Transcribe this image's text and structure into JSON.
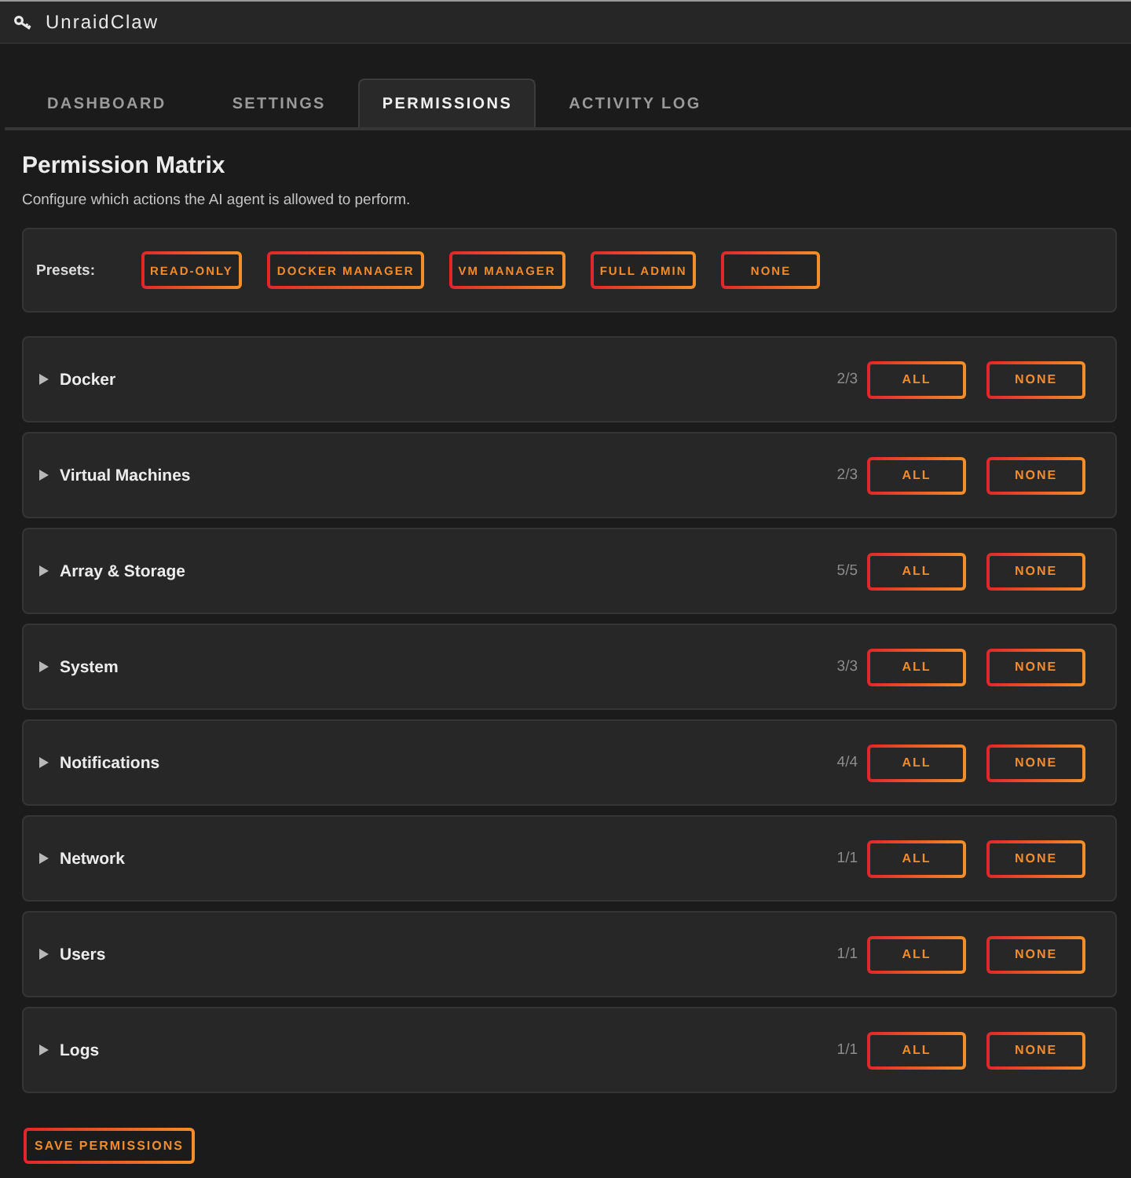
{
  "window": {
    "title": "UnraidClaw"
  },
  "tabs": [
    {
      "label": "DASHBOARD",
      "selected": false
    },
    {
      "label": "SETTINGS",
      "selected": false
    },
    {
      "label": "PERMISSIONS",
      "selected": true
    },
    {
      "label": "ACTIVITY LOG",
      "selected": false
    }
  ],
  "page": {
    "title": "Permission Matrix",
    "description": "Configure which actions the AI agent is allowed to perform."
  },
  "presets": {
    "label": "Presets:",
    "buttons": [
      "READ-ONLY",
      "DOCKER MANAGER",
      "VM MANAGER",
      "FULL ADMIN",
      "NONE"
    ]
  },
  "sections": [
    {
      "name": "Docker",
      "expanded": false,
      "count": "2/3",
      "all_button": "ALL",
      "none_button": "NONE"
    },
    {
      "name": "Virtual Machines",
      "expanded": false,
      "count": "2/3",
      "all_button": "ALL",
      "none_button": "NONE"
    },
    {
      "name": "Array & Storage",
      "expanded": false,
      "count": "5/5",
      "all_button": "ALL",
      "none_button": "NONE"
    },
    {
      "name": "System",
      "expanded": false,
      "count": "3/3",
      "all_button": "ALL",
      "none_button": "NONE"
    },
    {
      "name": "Notifications",
      "expanded": false,
      "count": "4/4",
      "all_button": "ALL",
      "none_button": "NONE"
    },
    {
      "name": "Network",
      "expanded": false,
      "count": "1/1",
      "all_button": "ALL",
      "none_button": "NONE"
    },
    {
      "name": "Users",
      "expanded": false,
      "count": "1/1",
      "all_button": "ALL",
      "none_button": "NONE"
    },
    {
      "name": "Logs",
      "expanded": false,
      "count": "1/1",
      "all_button": "ALL",
      "none_button": "NONE"
    }
  ],
  "save_button": "SAVE PERMISSIONS"
}
